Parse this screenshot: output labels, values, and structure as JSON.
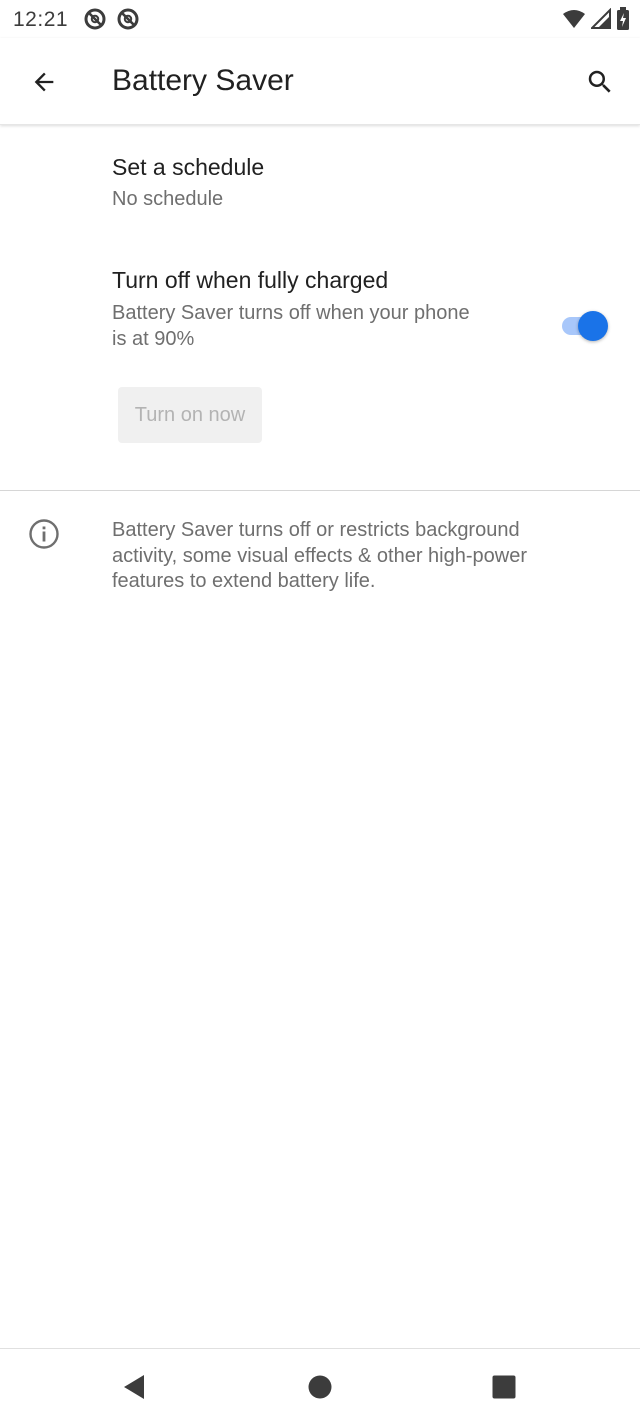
{
  "status_bar": {
    "time": "12:21",
    "left_icons": [
      "do-not-disturb-icon",
      "do-not-disturb-icon"
    ],
    "right_icons": [
      "wifi-icon",
      "cell-signal-icon",
      "battery-charging-icon"
    ]
  },
  "app_bar": {
    "title": "Battery Saver",
    "back_icon": "arrow-back-icon",
    "search_icon": "search-icon"
  },
  "preferences": {
    "schedule": {
      "title": "Set a schedule",
      "summary": "No schedule"
    },
    "auto_off": {
      "title": "Turn off when fully charged",
      "summary_line1": "Battery Saver turns off when your phone",
      "summary_line2": "is at 90%",
      "enabled": true
    }
  },
  "turn_on_button": {
    "label": "Turn on now",
    "enabled": false
  },
  "info": {
    "icon": "info-icon",
    "line1": "Battery Saver turns off or restricts background",
    "line2": "activity, some visual effects & other high-power",
    "line3": "features to extend battery life."
  },
  "nav_bar": {
    "icons": [
      "back-triangle-icon",
      "home-circle-icon",
      "recents-square-icon"
    ]
  },
  "colors": {
    "accent": "#1a73e8",
    "accent_track": "#a8c7fa",
    "title_text": "#212121",
    "secondary_text": "#6f6f6f"
  }
}
